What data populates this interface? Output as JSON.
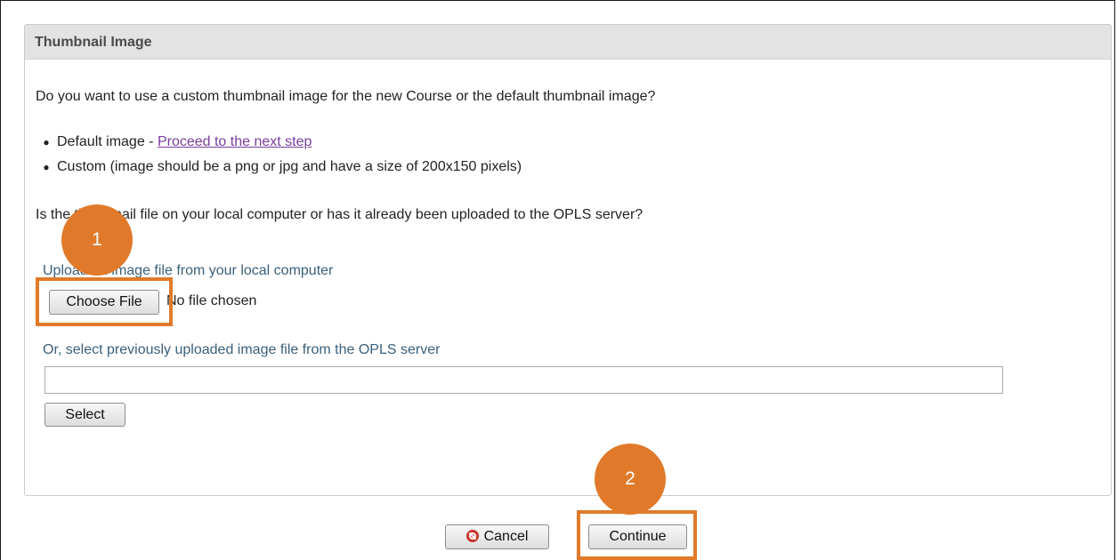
{
  "panel": {
    "title": "Thumbnail Image",
    "question_thumbnail_type": "Do you want to use a custom thumbnail image for the new Course or the default thumbnail image?",
    "options": [
      {
        "prefix": "Default image - ",
        "link_text": "Proceed to the next step"
      },
      {
        "text": "Custom (image should be a png or jpg and have a size of 200x150 pixels)"
      }
    ],
    "question_location": "Is the thumbnail file on your local computer or has it already been uploaded to the OPLS server?",
    "upload_label": "Upload an image file from your local computer",
    "choose_file_label": "Choose File",
    "no_file_text": "No file chosen",
    "server_label": "Or, select previously uploaded image file from the OPLS server",
    "server_input_value": "",
    "select_label": "Select"
  },
  "footer": {
    "cancel_label": "Cancel",
    "cancel_icon": "cancel-circle-icon",
    "continue_label": "Continue"
  },
  "annotations": {
    "step1": "1",
    "step2": "2",
    "highlight_color": "#e07a2a"
  }
}
